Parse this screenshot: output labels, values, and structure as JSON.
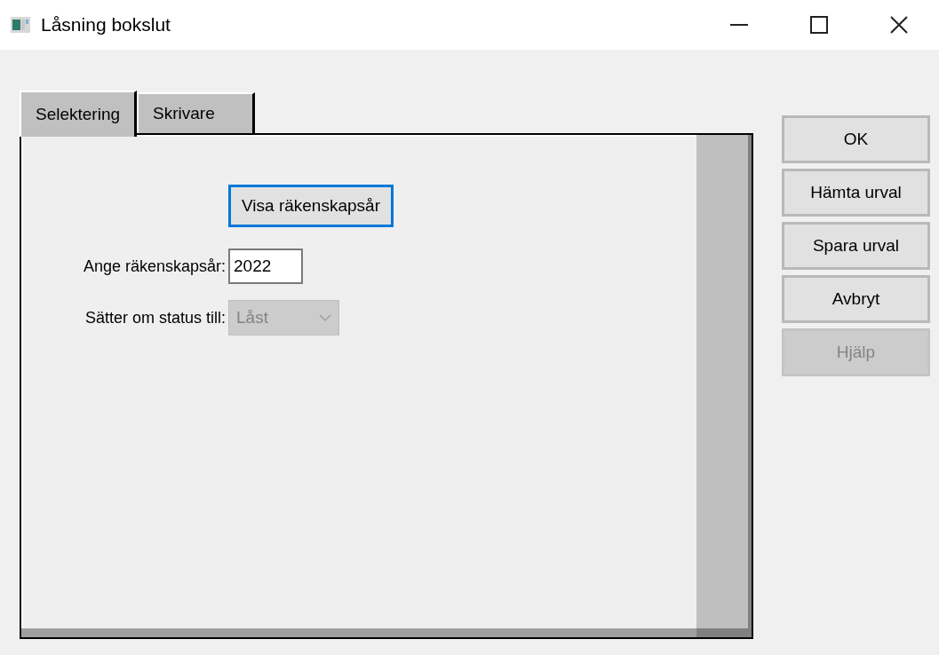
{
  "window": {
    "title": "Låsning bokslut"
  },
  "tabs": [
    {
      "label": "Selektering",
      "selected": true
    },
    {
      "label": "Skrivare",
      "selected": false
    }
  ],
  "show_button": {
    "label": "Visa räkenskapsår",
    "focused": true
  },
  "fields": [
    {
      "kind": "text",
      "label": "Ange räkenskapsår:",
      "value": "2022",
      "disabled": false
    },
    {
      "kind": "dropdown",
      "label": "Sätter om status till:",
      "value": "Låst",
      "disabled": true
    }
  ],
  "buttons": [
    {
      "label": "OK",
      "disabled": false
    },
    {
      "label": "Hämta urval",
      "disabled": false
    },
    {
      "label": "Spara urval",
      "disabled": false
    },
    {
      "label": "Avbryt",
      "disabled": false
    },
    {
      "label": "Hjälp",
      "disabled": true
    }
  ]
}
